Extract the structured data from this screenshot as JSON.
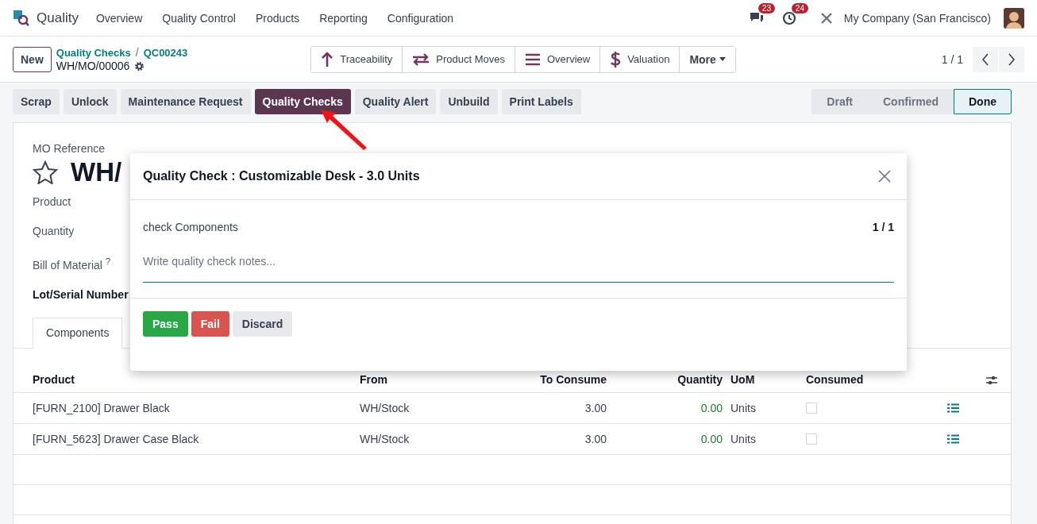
{
  "navbar": {
    "app_name": "Quality",
    "menu": [
      "Overview",
      "Quality Control",
      "Products",
      "Reporting",
      "Configuration"
    ],
    "messages_count": "23",
    "activities_count": "24",
    "company": "My Company (San Francisco)"
  },
  "control_panel": {
    "new_button": "New",
    "breadcrumb": [
      "Quality Checks",
      "QC00243"
    ],
    "breadcrumb_separator": "/",
    "record": "WH/MO/00006",
    "smart_buttons": [
      {
        "label": "Traceability",
        "kind": "arrow-up"
      },
      {
        "label": "Product Moves",
        "kind": "arrows"
      },
      {
        "label": "Overview",
        "kind": "list"
      },
      {
        "label": "Valuation",
        "kind": "dollar"
      }
    ],
    "more": "More",
    "pager": "1 / 1"
  },
  "actions": [
    {
      "label": "Scrap",
      "selected": false
    },
    {
      "label": "Unlock",
      "selected": false
    },
    {
      "label": "Maintenance Request",
      "selected": false
    },
    {
      "label": "Quality Checks",
      "selected": true
    },
    {
      "label": "Quality Alert",
      "selected": false
    },
    {
      "label": "Unbuild",
      "selected": false
    },
    {
      "label": "Print Labels",
      "selected": false
    }
  ],
  "statusbar": [
    {
      "label": "Draft",
      "selected": false
    },
    {
      "label": "Confirmed",
      "selected": false
    },
    {
      "label": "Done",
      "selected": true
    }
  ],
  "form": {
    "ref_label": "MO Reference",
    "title": "WH/",
    "starred": false,
    "fields": [
      {
        "label": "Product",
        "bold": false
      },
      {
        "label": "Quantity",
        "bold": false
      },
      {
        "label": "Bill of Material $^{?}$",
        "bold": false
      },
      {
        "label": "Lot/Serial Number",
        "bold": true
      }
    ],
    "tabs": [
      {
        "label": "Components",
        "selected": true
      }
    ],
    "columns": [
      "Product",
      "From",
      "To Consume",
      "Quantity",
      "UoM",
      "Consumed"
    ],
    "rows": [
      {
        "product": "[FURN_2100] Drawer Black",
        "from": "WH/Stock",
        "to_consume": "3.00",
        "quantity": "0.00",
        "uom": "Units",
        "consumed": false
      },
      {
        "product": "[FURN_5623] Drawer Case Black",
        "from": "WH/Stock",
        "to_consume": "3.00",
        "quantity": "0.00",
        "uom": "Units",
        "consumed": false
      }
    ]
  },
  "dialog": {
    "title": "Quality Check : Customizable Desk - 3.0 Units",
    "step": "check Components",
    "counter": "1 / 1",
    "placeholder": "Write quality check notes...",
    "buttons": [
      {
        "label": "Pass",
        "kind": "pass"
      },
      {
        "label": "Fail",
        "kind": "fail"
      },
      {
        "label": "Discard",
        "kind": "discard"
      }
    ]
  }
}
